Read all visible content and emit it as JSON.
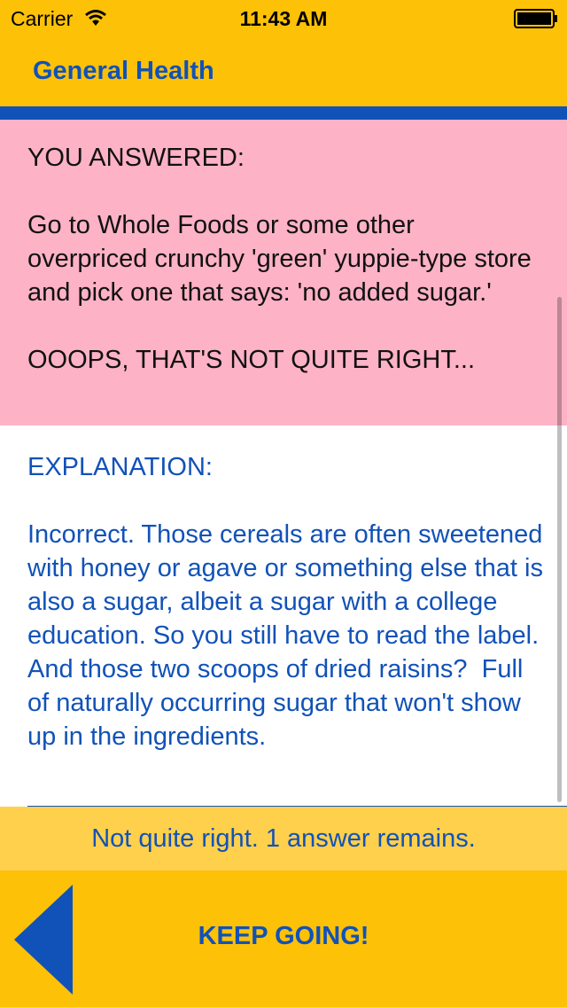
{
  "status_bar": {
    "carrier": "Carrier",
    "time": "11:43 AM",
    "icons": [
      "wifi-icon",
      "battery-icon"
    ]
  },
  "header": {
    "title": "General Health"
  },
  "answer": {
    "heading": "YOU ANSWERED:",
    "text": "Go to Whole Foods or some other overpriced crunchy 'green' yuppie-type store and pick one that says: 'no added sugar.'",
    "verdict": "OOOPS, THAT'S NOT QUITE RIGHT..."
  },
  "explanation": {
    "heading": "EXPLANATION:",
    "text": "Incorrect. Those cereals are often sweetened with honey or agave or something else that is also a sugar, albeit a sugar with a college education. So you still have to read the label. And those two scoops of dried raisins?  Full of naturally occurring sugar that won't show up in the ingredients."
  },
  "status_message": "Not quite right. 1 answer remains.",
  "bottom": {
    "continue_label": "KEEP GOING!",
    "back_icon": "left-arrow-icon"
  },
  "colors": {
    "yellow": "#fdc108",
    "blue": "#1152b8",
    "pink": "#feb2c6",
    "light_yellow": "#fed04c"
  }
}
